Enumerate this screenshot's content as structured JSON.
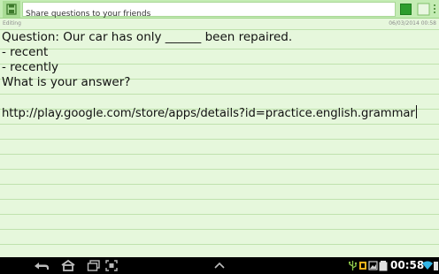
{
  "toolbar": {
    "title_value": "Share questions to your friends",
    "save_icon": "save-disk-icon",
    "color_swatch": "#2e9d2e",
    "check_icon": "checkbox-icon",
    "menu_icon": "overflow-menu-icon"
  },
  "status": {
    "mode": "Editing",
    "datetime": "06/03/2014 00:58"
  },
  "note": {
    "lines": [
      "Question: Our car has only ______ been repaired.",
      "- recent",
      "- recently",
      "What is your answer?",
      "",
      "http://play.google.com/store/apps/details?id=practice.english.grammar"
    ]
  },
  "system_bar": {
    "clock": "00:58",
    "icons": [
      "back-icon",
      "home-icon",
      "recent-apps-icon",
      "screenshot-icon",
      "up-chevron-icon",
      "usb-icon",
      "debug-icon",
      "photo-icon",
      "wifi-icon",
      "battery-icon"
    ]
  },
  "colors": {
    "background": "#e6f7dc",
    "toolbar": "#c4ecb4",
    "rule_line": "#bfe2ad",
    "accent": "#2e9d2e"
  }
}
